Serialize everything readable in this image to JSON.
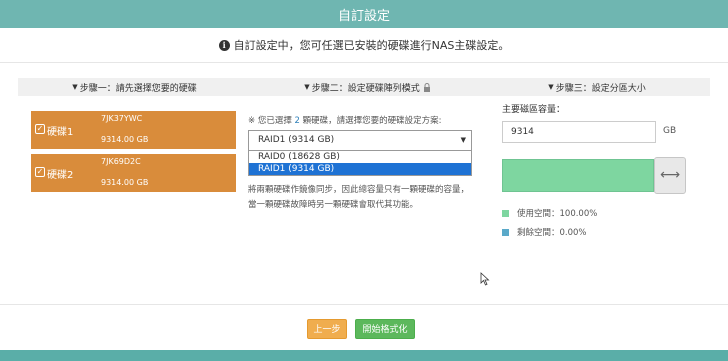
{
  "dialog": {
    "title": "自訂設定",
    "notice": "自訂設定中，您可任選已安裝的硬碟進行NAS主碟設定。"
  },
  "steps": {
    "step1": "步驟一：請先選擇您要的硬碟",
    "step2": "步驟二：設定硬碟陣列模式",
    "step3": "步驟三：設定分區大小"
  },
  "disks": [
    {
      "name": "硬碟1",
      "serial": "7JK37YWC",
      "size": "9314.00 GB",
      "checked": true
    },
    {
      "name": "硬碟2",
      "serial": "7JK69D2C",
      "size": "9314.00 GB",
      "checked": true
    }
  ],
  "raid": {
    "selected_prefix": "※ 您已選擇",
    "selected_count": "2",
    "selected_suffix": "顆硬碟，請選擇您要的硬碟設定方案:",
    "current_value": "RAID1 (9314 GB)",
    "options": [
      "RAID0 (18628 GB)",
      "RAID1 (9314 GB)"
    ],
    "highlighted_option": "RAID1 (9314 GB)",
    "description": "將兩顆硬碟作鏡像同步，因此總容量只有一顆硬碟的容量，當一顆硬碟故障時另一顆硬碟會取代其功能。"
  },
  "partition": {
    "label": "主要磁區容量：",
    "value": "9314",
    "unit": "GB",
    "used_fraction": 1.0,
    "used_label": "使用空間：100.00%",
    "free_label": "剩餘空間：0.00%"
  },
  "colors": {
    "titlebar": "#6fb6b1",
    "disk_selected": "#d98c3b",
    "used": "#7ed6a0",
    "free": "#5aa9c9",
    "back_button": "#f0ad4e",
    "start_button": "#5cb85c",
    "option_highlight": "#1e72d4"
  },
  "buttons": {
    "back": "上一步",
    "start": "開始格式化"
  },
  "icons": {
    "info": "info-icon",
    "lock": "lock-icon",
    "checkbox": "checkbox-checked-icon",
    "resize": "horizontal-resize-icon"
  }
}
